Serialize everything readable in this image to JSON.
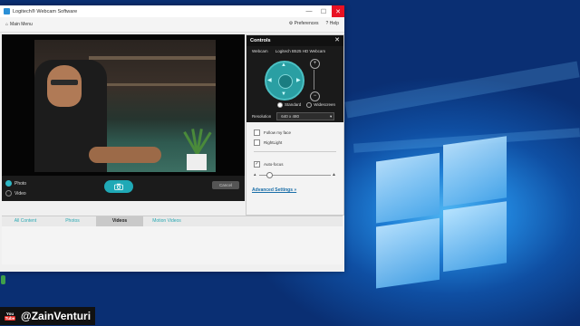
{
  "window": {
    "title": "Logitech® Webcam Software",
    "controls": {
      "minimize": "—",
      "maximize": "☐",
      "close": "✕"
    }
  },
  "menu": {
    "main_menu": "Main Menu",
    "preferences": "Preferences",
    "help": "Help"
  },
  "preview": {
    "modes": [
      {
        "label": "Photo",
        "selected": true
      },
      {
        "label": "Video",
        "selected": false
      }
    ],
    "capture_icon": "camera-icon",
    "cancel_label": "Cancel"
  },
  "controls_panel": {
    "title": "Controls",
    "close": "✕",
    "webcam_label": "Webcam",
    "webcam_name": "Logitech B525 HD Webcam",
    "view_modes": [
      {
        "label": "Standard",
        "selected": true
      },
      {
        "label": "Widescreen",
        "selected": false
      }
    ],
    "resolution_label": "Resolution",
    "resolution_value": "640 x 480",
    "checkboxes": [
      {
        "label": "Follow my face",
        "checked": false
      },
      {
        "label": "RightLight",
        "checked": false
      }
    ],
    "autofocus": {
      "label": "Auto-focus",
      "checked": true
    },
    "advanced_settings": "Advanced Settings »"
  },
  "tabs": [
    {
      "label": "All Content",
      "active": false
    },
    {
      "label": "Photos",
      "active": false
    },
    {
      "label": "Videos",
      "active": true
    },
    {
      "label": "Motion Videos",
      "active": false
    }
  ],
  "overlay": {
    "you": "You",
    "tube": "Tube",
    "handle": "@ZainVenturi"
  },
  "colors": {
    "accent": "#2fb8c6",
    "close_red": "#e81123",
    "desktop_blue": "#1f7fd6"
  }
}
